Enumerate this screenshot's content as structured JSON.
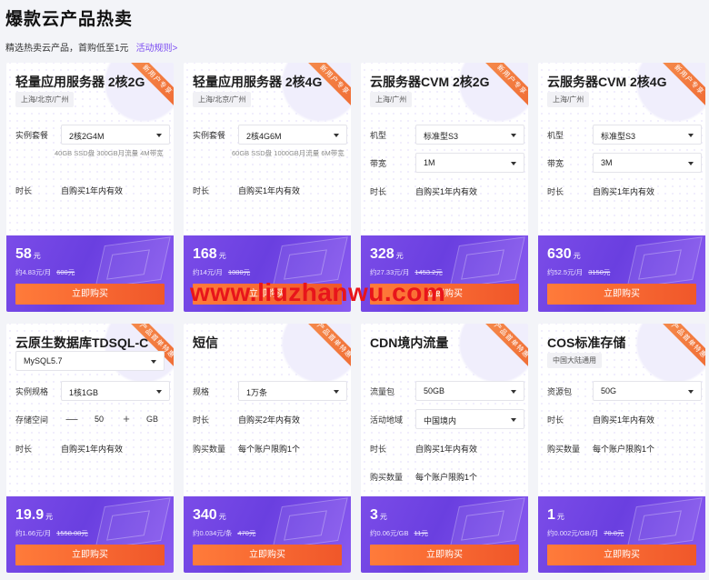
{
  "header": {
    "title": "爆款云产品热卖",
    "subtitle": "精选热卖云产品，首购低至1元",
    "rules_link": "活动规则>"
  },
  "watermark": "www.liuzhanwu.com",
  "cards": [
    {
      "title": "轻量应用服务器 2核2G",
      "region": "上海/北京/广州",
      "ribbon": "新用户专享",
      "rows": [
        {
          "label": "实例套餐",
          "select": "2核2G4M",
          "note": "40GB SSD盘 300GB月流量 4M带宽"
        },
        {
          "label": "时长",
          "value": "自购买1年内有效"
        }
      ],
      "price": "58",
      "unit": "元",
      "per": "约4.83元/月",
      "original": "600元",
      "buy": "立即购买"
    },
    {
      "title": "轻量应用服务器 2核4G",
      "region": "上海/北京/广州",
      "ribbon": "新用户专享",
      "rows": [
        {
          "label": "实例套餐",
          "select": "2核4G6M",
          "note": "60GB SSD盘 1000GB月流量 6M带宽"
        },
        {
          "label": "时长",
          "value": "自购买1年内有效"
        }
      ],
      "price": "168",
      "unit": "元",
      "per": "约14元/月",
      "original": "1080元",
      "buy": "立即购买"
    },
    {
      "title": "云服务器CVM 2核2G",
      "region": "上海/广州",
      "ribbon": "新用户专享",
      "rows": [
        {
          "label": "机型",
          "select": "标准型S3"
        },
        {
          "label": "带宽",
          "select": "1M"
        },
        {
          "label": "时长",
          "value": "自购买1年内有效"
        }
      ],
      "price": "328",
      "unit": "元",
      "per": "约27.33元/月",
      "original": "1453.2元",
      "buy": "立即购买"
    },
    {
      "title": "云服务器CVM 2核4G",
      "region": "上海/广州",
      "ribbon": "新用户专享",
      "rows": [
        {
          "label": "机型",
          "select": "标准型S3"
        },
        {
          "label": "带宽",
          "select": "3M"
        },
        {
          "label": "时长",
          "value": "自购买1年内有效"
        }
      ],
      "price": "630",
      "unit": "元",
      "per": "约52.5元/月",
      "original": "3150元",
      "buy": "立即购买"
    },
    {
      "title": "云原生数据库TDSQL-C",
      "ribbon": "产品首单特惠",
      "top_select": "MySQL5.7",
      "rows": [
        {
          "label": "实例规格",
          "select": "1核1GB"
        },
        {
          "label": "存储空间",
          "stepper": "50",
          "stepper_unit": "GB",
          "minus": "—",
          "plus": "+"
        },
        {
          "label": "时长",
          "value": "自购买1年内有效"
        }
      ],
      "price": "19.9",
      "unit": "元",
      "per": "约1.66元/月",
      "original": "1558.08元",
      "buy": "立即购买"
    },
    {
      "title": "短信",
      "ribbon": "产品首单特惠",
      "rows": [
        {
          "label": "规格",
          "select": "1万条"
        },
        {
          "label": "时长",
          "value": "自购买2年内有效"
        },
        {
          "label": "购买数量",
          "value": "每个账户限购1个"
        }
      ],
      "price": "340",
      "unit": "元",
      "per": "约0.034元/条",
      "original": "470元",
      "buy": "立即购买"
    },
    {
      "title": "CDN境内流量",
      "ribbon": "产品首单特惠",
      "rows": [
        {
          "label": "流量包",
          "select": "50GB"
        },
        {
          "label": "活动地域",
          "select": "中国境内"
        },
        {
          "label": "时长",
          "value": "自购买1年内有效"
        },
        {
          "label": "购买数量",
          "value": "每个账户限购1个"
        }
      ],
      "price": "3",
      "unit": "元",
      "per": "约0.06元/GB",
      "original": "11元",
      "buy": "立即购买"
    },
    {
      "title": "COS标准存储",
      "region": "中国大陆通用",
      "ribbon": "产品首单特惠",
      "rows": [
        {
          "label": "资源包",
          "select": "50G"
        },
        {
          "label": "时长",
          "value": "自购买1年内有效"
        },
        {
          "label": "购买数量",
          "value": "每个账户限购1个"
        }
      ],
      "price": "1",
      "unit": "元",
      "per": "约0.002元/GB/月",
      "original": "70.8元",
      "buy": "立即购买"
    }
  ]
}
